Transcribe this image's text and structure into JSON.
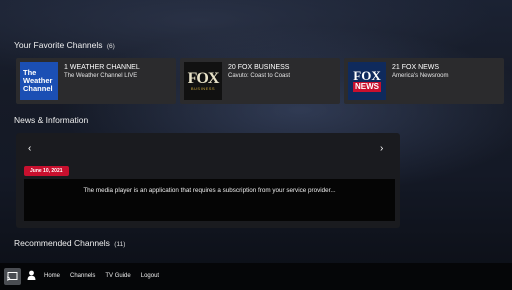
{
  "favorites": {
    "title": "Your Favorite Channels",
    "count": "(6)",
    "channels": [
      {
        "logo_text_1": "The",
        "logo_text_2": "Weather",
        "logo_text_3": "Channel",
        "title": "1 WEATHER CHANNEL",
        "show": "The Weather Channel LIVE"
      },
      {
        "logo_text_1": "FOX",
        "logo_text_2": "BUSINESS",
        "title": "20 FOX BUSINESS",
        "show": "Cavuto: Coast to Coast"
      },
      {
        "logo_text_1": "FOX",
        "logo_text_2": "NEWS",
        "title": "21 FOX NEWS",
        "show": "America's Newsroom"
      }
    ]
  },
  "news": {
    "title": "News & Information",
    "prev_arrow": "‹",
    "next_arrow": "›",
    "date": "June 10, 2021",
    "message": "The media player is an application that requires a subscription from your service provider..."
  },
  "recommended": {
    "title": "Recommended Channels",
    "count": "(11)"
  },
  "nav": {
    "items": [
      "Home",
      "Channels",
      "TV Guide",
      "Logout"
    ]
  }
}
